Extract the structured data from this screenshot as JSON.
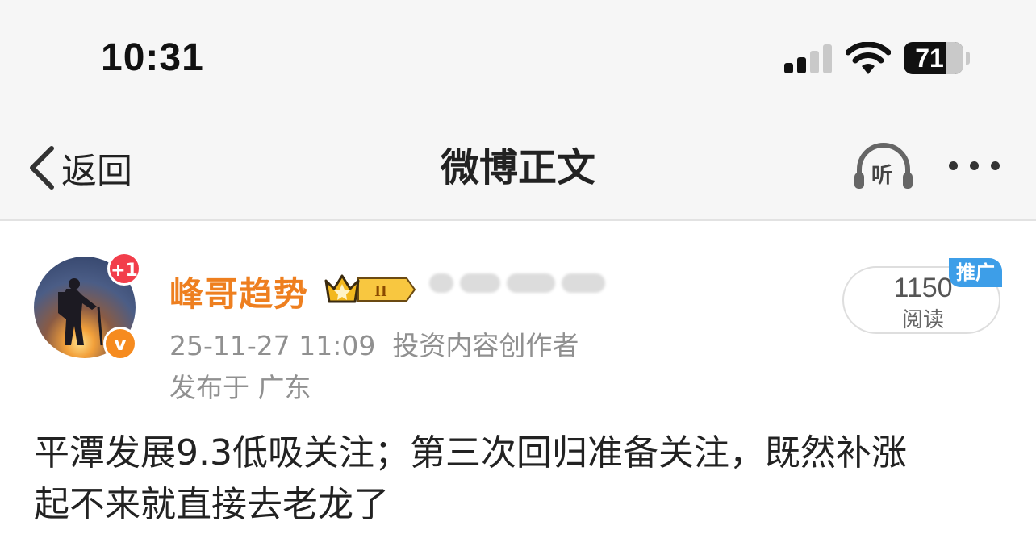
{
  "status_bar": {
    "time": "10:31",
    "battery": "71"
  },
  "nav": {
    "back_label": "返回",
    "title": "微博正文",
    "listen_label": "听"
  },
  "post": {
    "author": "峰哥趋势",
    "badge_level": "II",
    "date": "25-11-27 11:09",
    "author_tag": "投资内容创作者",
    "location": "发布于 广东",
    "avatar_badge": "+1",
    "verified_badge": "v",
    "reads": "1150",
    "reads_label": "阅读",
    "promo_tag": "推广",
    "text_lines": [
      "平潭发展9.3低吸关注；第三次回归准备关注，既然补涨",
      "起不来就直接去老龙了"
    ]
  },
  "colors": {
    "username": "#ee7f1f",
    "promo": "#3d9ee8",
    "notification": "#f23e4b",
    "verified": "#f68b1f"
  }
}
